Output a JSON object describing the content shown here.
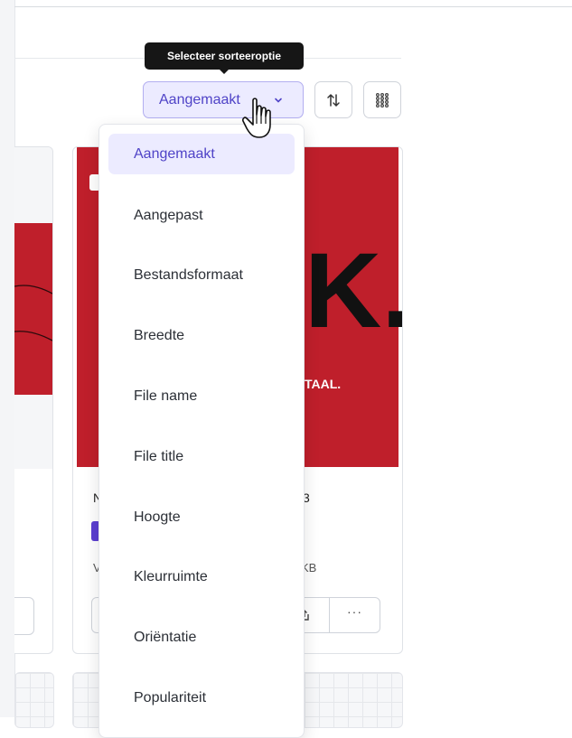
{
  "tooltip": {
    "text": "Selecteer sorteeroptie"
  },
  "sort": {
    "label": "Aangemaakt",
    "options": [
      "Aangemaakt",
      "Aangepast",
      "Bestandsformaat",
      "Breedte",
      "File name",
      "File title",
      "Hoogte",
      "Kleurruimte",
      "Oriëntatie",
      "Populariteit"
    ],
    "selected_index": 0
  },
  "card": {
    "title_start": "N",
    "title_end": "3",
    "meta_start": "V",
    "meta_end": "KB",
    "thumb_glyph": "K.",
    "thumb_tagline": "TAAL.",
    "more_label": "···"
  },
  "icons": {
    "sort_direction": "sort-direction-icon",
    "grid_view": "grid-view-icon",
    "chevron": "chevron-down-icon",
    "cursor": "hand-pointer-cursor",
    "share": "share-icon",
    "more": "more-icon"
  },
  "colors": {
    "accent": "#4f43c7",
    "accent_bg": "#ecebff",
    "thumbnail_red": "#bf1f2b",
    "tooltip_bg": "#161616"
  }
}
